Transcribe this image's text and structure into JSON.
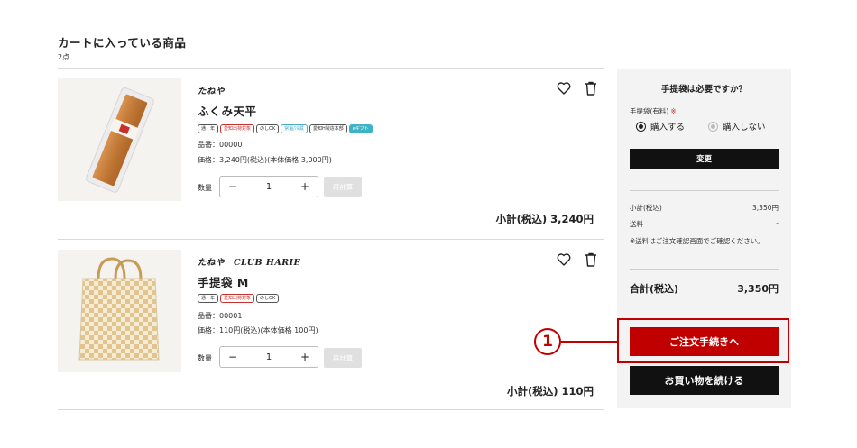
{
  "cart": {
    "title": "カートに入っている商品",
    "count": "2点"
  },
  "items": [
    {
      "brand": "たねや",
      "name": "ふくみ天平",
      "tags": [
        {
          "label": "通　年",
          "style": "plain"
        },
        {
          "label": "愛知出荷対象",
          "style": "red"
        },
        {
          "label": "のしOK",
          "style": "plain"
        },
        {
          "label": "常温/冷蔵",
          "style": "blue"
        },
        {
          "label": "愛知H製造本部",
          "style": "plain"
        },
        {
          "label": "eギフト",
          "style": "gift"
        }
      ],
      "sku": "品番：00000",
      "price": "価格：3,240円(税込)(本体価格 3,000円)",
      "qty_label": "数量",
      "qty_value": "1",
      "qty_minus": "−",
      "qty_plus": "+",
      "recalc": "再計算",
      "subtotal": "小計(税込) 3,240円",
      "heart_icon": "heart-icon",
      "trash_icon": "trash-icon"
    },
    {
      "brand": "たねや　CLUB HARIE",
      "name": "手提袋 M",
      "tags": [
        {
          "label": "通　年",
          "style": "plain"
        },
        {
          "label": "愛知出荷対象",
          "style": "red"
        },
        {
          "label": "のしOK",
          "style": "plain"
        }
      ],
      "sku": "品番：00001",
      "price": "価格：110円(税込)(本体価格 100円)",
      "qty_label": "数量",
      "qty_value": "1",
      "qty_minus": "−",
      "qty_plus": "+",
      "recalc": "再計算",
      "subtotal": "小計(税込) 110円",
      "heart_icon": "heart-icon",
      "trash_icon": "trash-icon"
    }
  ],
  "sidebar": {
    "question": "手提袋は必要ですか？",
    "bag_label": "手提袋(有料)",
    "bag_mark": "※",
    "option_yes": "購入する",
    "option_no": "購入しない",
    "selected": "yes",
    "change_button": "変更",
    "subtotal_label": "小計(税込)",
    "subtotal_value": "3,350円",
    "shipping_label": "送料",
    "shipping_value": "-",
    "shipping_note": "※送料はご注文確認画面でご確認ください。",
    "total_label": "合計(税込)",
    "total_value": "3,350円",
    "checkout_button": "ご注文手続きへ",
    "continue_button": "お買い物を続ける"
  },
  "callout": {
    "number": "1"
  },
  "colors": {
    "accent_red": "#c00000",
    "black": "#111111",
    "panel_bg": "#f3f3f3"
  }
}
